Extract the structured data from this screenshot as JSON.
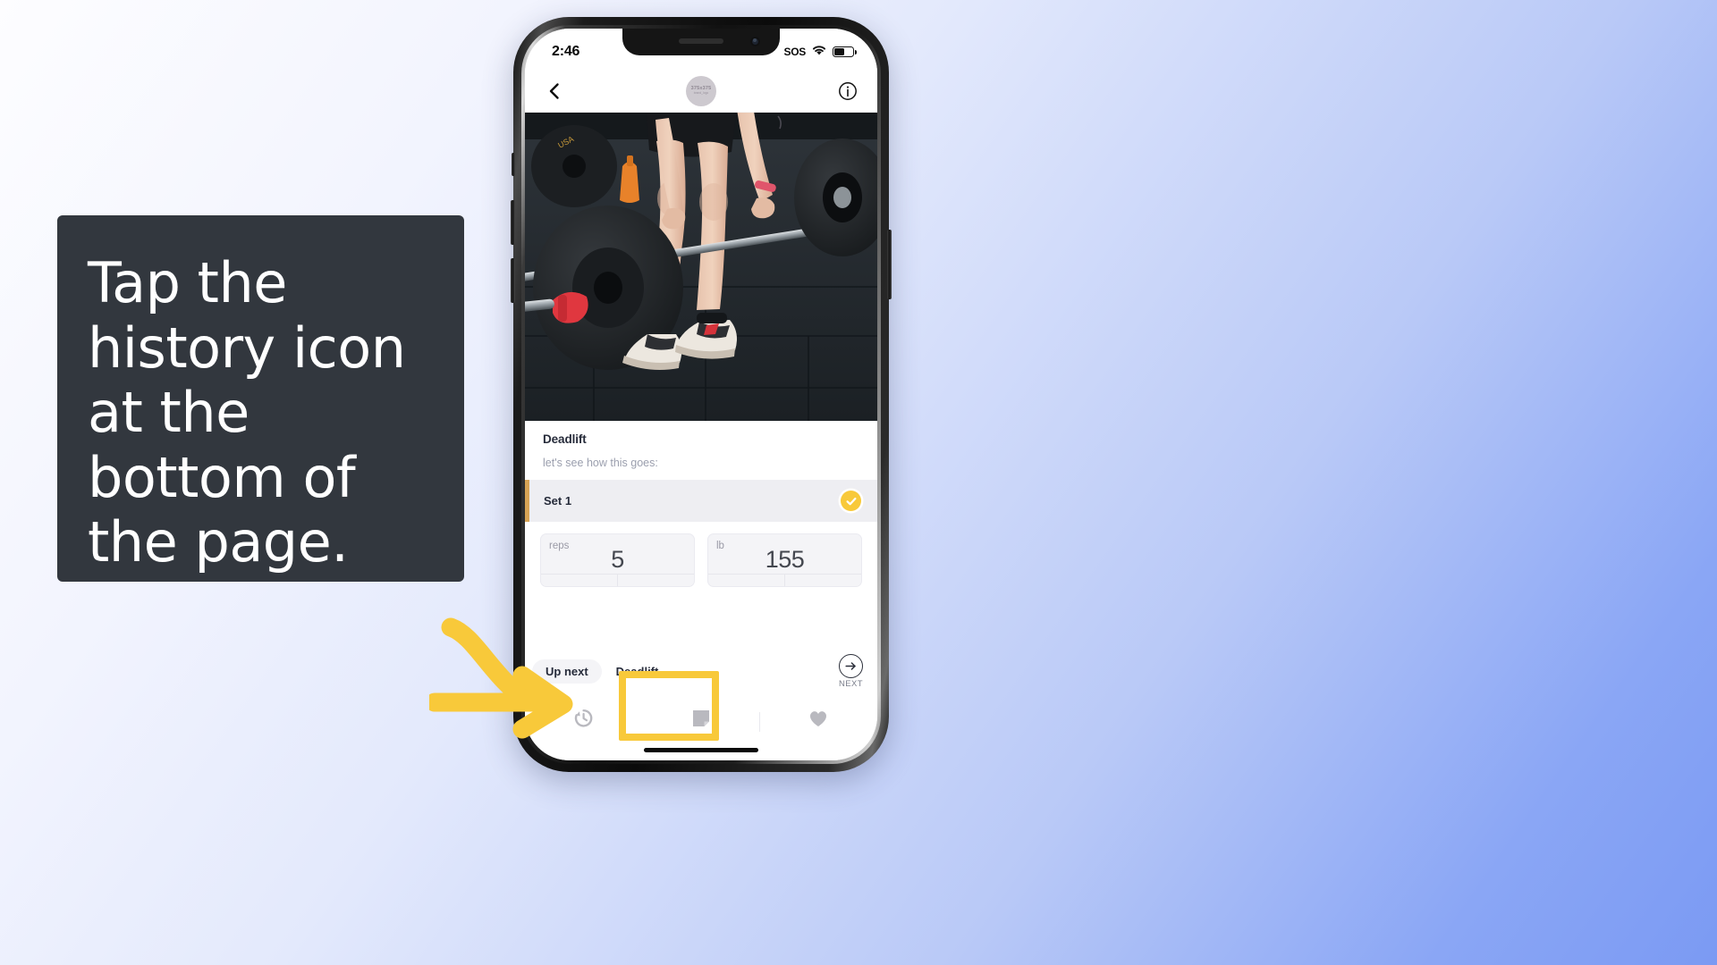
{
  "background": {
    "from": "#fdfdff",
    "to": "#7b9af3"
  },
  "instruction": {
    "text": "Tap the history icon at the bottom of the page.",
    "card_color": "#32373e",
    "text_color": "#ffffff"
  },
  "annotation": {
    "arrow_color": "#f8c93a",
    "highlight_color": "#f8c93a",
    "highlight_target": "history-tab"
  },
  "phone": {
    "status_bar": {
      "time": "2:46",
      "sos_label": "SOS",
      "wifi_icon": "wifi-icon",
      "battery_icon": "battery-icon",
      "battery_level_percent": 55
    },
    "app_navbar": {
      "back_icon": "chevron-left-icon",
      "avatar_main": "375x375",
      "avatar_sub": "brand_logo",
      "info_icon": "info-circle-icon"
    },
    "hero": {
      "alt": "athlete performing a barbell deadlift in a gym"
    },
    "exercise": {
      "title": "Deadlift",
      "note": "let's see how this goes:",
      "set_label": "Set 1",
      "set_completed_icon": "check-circle-icon",
      "accent_bar_color": "#d6a355",
      "check_color": "#f8c93a",
      "inputs": [
        {
          "label": "reps",
          "value": "5"
        },
        {
          "label": "lb",
          "value": "155"
        }
      ]
    },
    "up_next": {
      "pill_label": "Up next",
      "exercise": "Deadlift",
      "next_icon": "arrow-right-circle-icon",
      "next_label": "NEXT"
    },
    "tab_bar": {
      "items": [
        {
          "icon": "history-icon",
          "name": "history"
        },
        {
          "icon": "note-icon",
          "name": "notes"
        },
        {
          "icon": "heart-icon",
          "name": "favorite"
        }
      ]
    }
  }
}
